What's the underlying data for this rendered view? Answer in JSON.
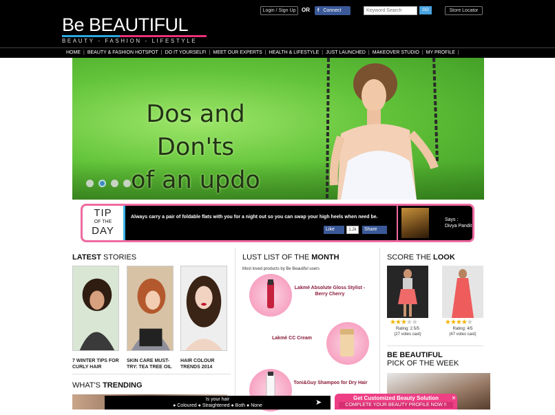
{
  "header": {
    "logo_be": "Be",
    "logo_beautiful": "BEAUTIFUL",
    "tagline": "BEAUTY - FASHION - LIFESTYLE",
    "login_label": "Login / Sign Up",
    "or_label": "OR",
    "fb_connect_label": "Connect",
    "search_placeholder": "Keyword Search",
    "go_label": "GO",
    "store_locator_label": "Store Locator"
  },
  "nav": {
    "items": [
      "HOME",
      "BEAUTY & FASHION HOTSPOT",
      "DO IT YOURSELF!",
      "MEET OUR EXPERTS",
      "HEALTH & LIFESTYLE",
      "JUST LAUNCHED",
      "MAKEOVER STUDIO",
      "MY PROFILE"
    ]
  },
  "hero": {
    "title_line1": "Dos and Don'ts",
    "title_line2": "of an updo",
    "slides_count": 4,
    "active_slide": 2
  },
  "tip": {
    "label_tip": "TIP",
    "label_of_the": "OF THE",
    "label_day": "DAY",
    "text": "Always carry a pair of foldable flats with you for a night out so you can swap your high heels when need be.",
    "like_label": "Like",
    "like_count": "1.2k",
    "share_label": "Share",
    "says_label": "Says :",
    "says_name": "Divya Pandit"
  },
  "latest": {
    "heading_bold": "LATEST",
    "heading_rest": " STORIES",
    "stories": [
      {
        "title": "7 WINTER TIPS FOR CURLY HAIR"
      },
      {
        "title": "SKIN CARE MUST-TRY: TEA TREE OIL"
      },
      {
        "title": "HAIR COLOUR TRENDS 2014"
      }
    ]
  },
  "trending": {
    "heading_rest": "WHAT'S ",
    "heading_bold": "TRENDING"
  },
  "lust": {
    "heading_rest": "LUST LIST OF THE ",
    "heading_bold": "MONTH",
    "subtitle": "Most loved products by Be Beautiful users",
    "products": [
      {
        "name": "Lakmé Absolute Gloss Stylist - Berry Cherry"
      },
      {
        "name": "Lakmé CC Cream"
      },
      {
        "name": "Toni&Guy Shampoo for Dry Hair"
      }
    ]
  },
  "score": {
    "heading_rest": "SCORE THE ",
    "heading_bold": "LOOK",
    "looks": [
      {
        "rating_text": "Rating: 2.5/5",
        "votes": "(27 votes cast)",
        "rating": 2.5
      },
      {
        "rating_text": "Rating: 4/5",
        "votes": "(47 votes cast)",
        "rating": 4
      }
    ]
  },
  "pick": {
    "line1": "BE BEAUTIFUL",
    "line2": "PICK OF THE WEEK"
  },
  "poll": {
    "question": "Is your hair",
    "options": [
      "Coloured",
      "Straightened",
      "Both",
      "None"
    ]
  },
  "beauty_solution": {
    "line1": "Get Customized Beauty Solution",
    "line2": "COMPLETE YOUR BEAUTY PROFILE NOW !!"
  },
  "colors": {
    "accent_pink": "#ee3f85",
    "accent_blue": "#3ab3e8",
    "facebook_blue": "#3b5998"
  }
}
